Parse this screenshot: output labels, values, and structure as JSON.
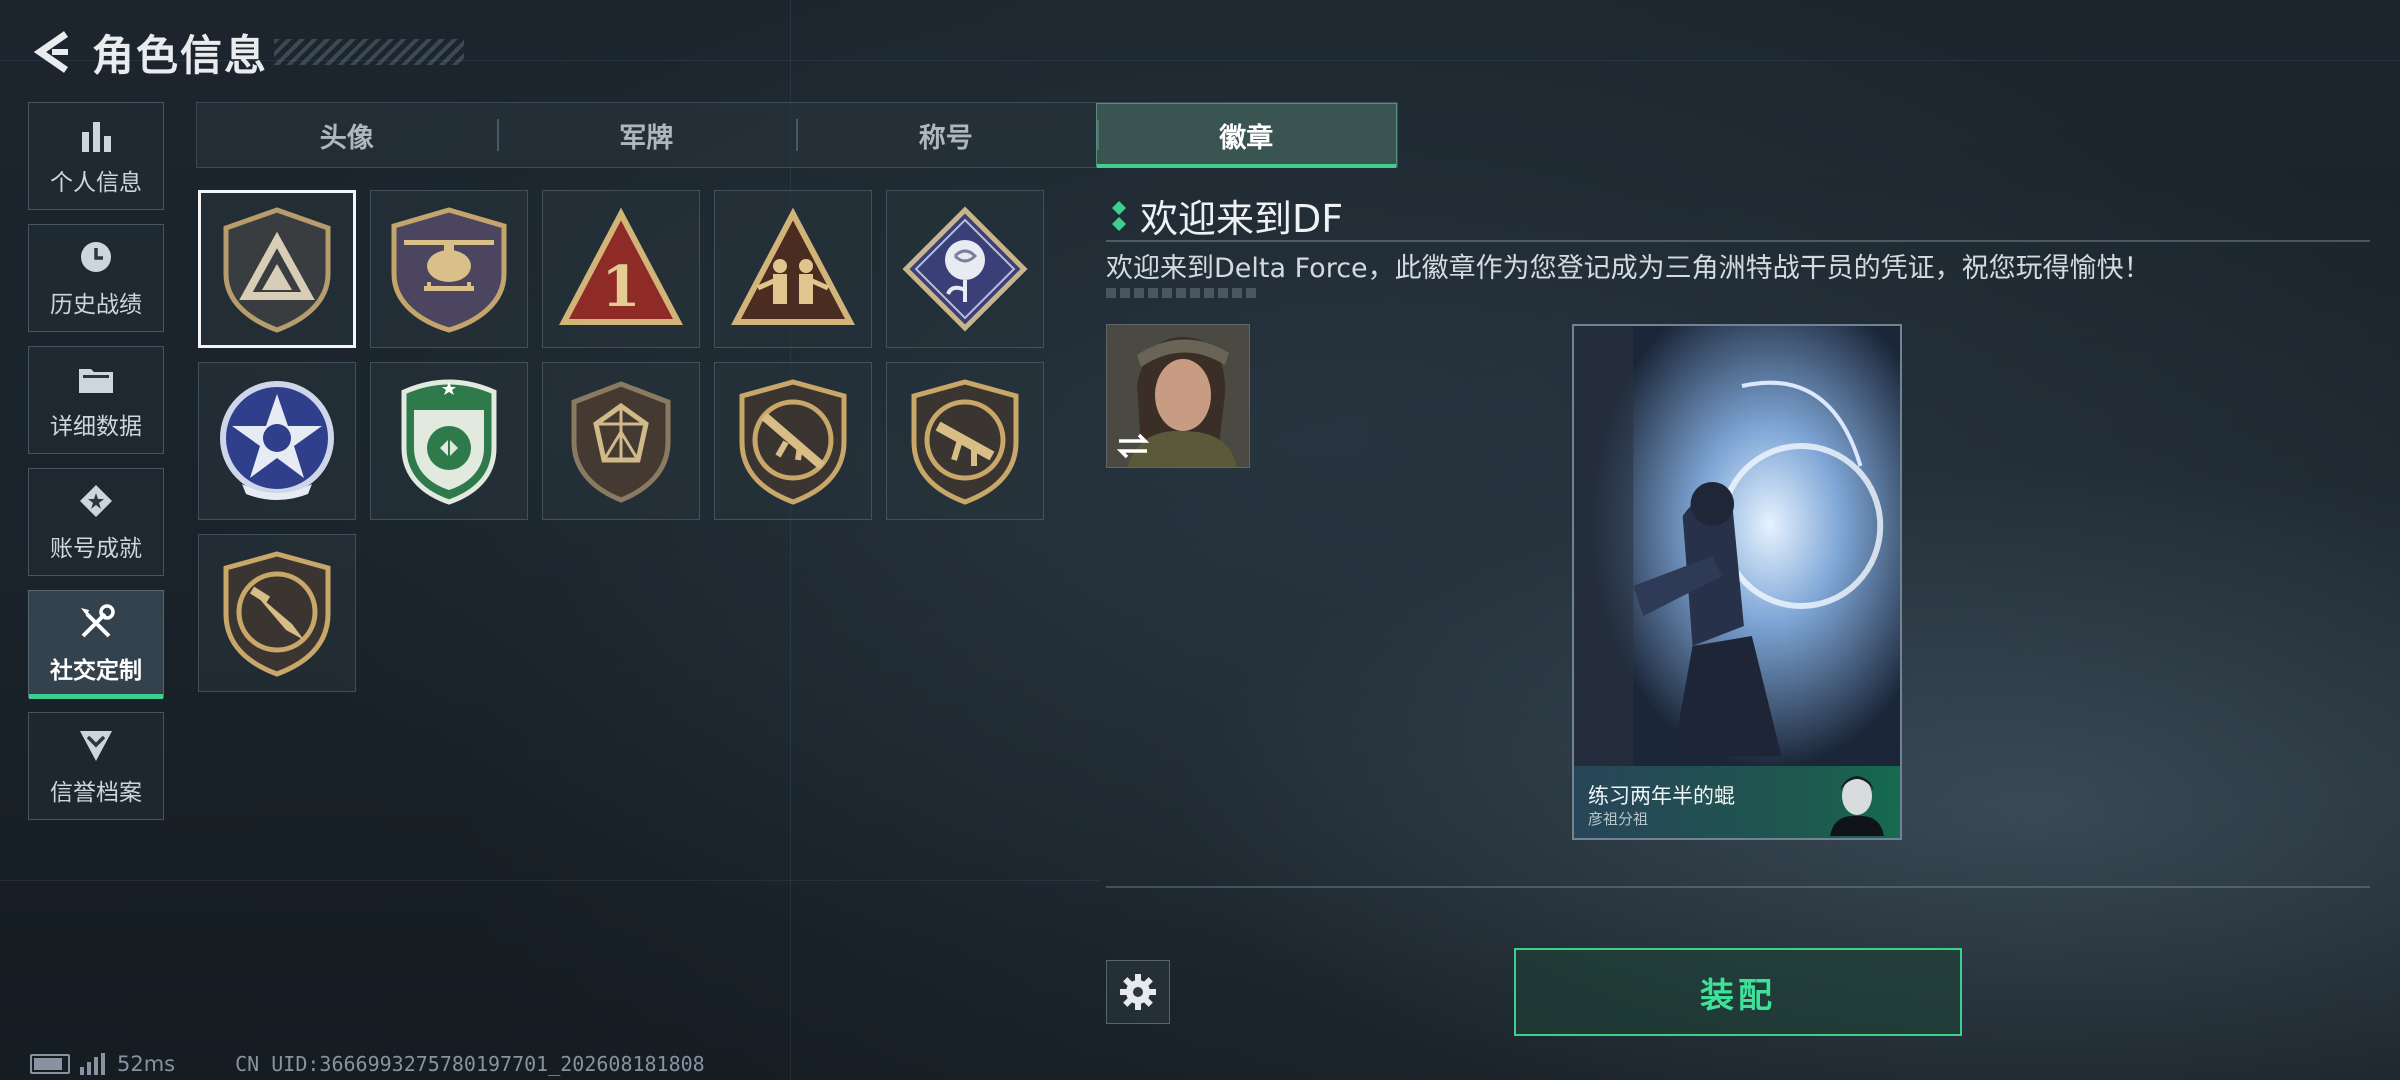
{
  "header": {
    "title": "角色信息"
  },
  "side_nav": [
    {
      "label": "个人信息",
      "icon": "bar-chart-icon"
    },
    {
      "label": "历史战绩",
      "icon": "clock-icon"
    },
    {
      "label": "详细数据",
      "icon": "folder-icon"
    },
    {
      "label": "账号成就",
      "icon": "achievement-icon"
    },
    {
      "label": "社交定制",
      "icon": "tools-icon",
      "active": true
    },
    {
      "label": "信誉档案",
      "icon": "shield-chevron-icon"
    }
  ],
  "tabs": [
    {
      "label": "头像"
    },
    {
      "label": "军牌"
    },
    {
      "label": "称号"
    },
    {
      "label": "徽章",
      "active": true
    }
  ],
  "badges": [
    "delta-triangle-badge-icon",
    "helicopter-badge-icon",
    "number-one-badge-icon",
    "soldiers-badge-icon",
    "rose-badge-icon",
    "skull-star-badge-icon",
    "green-shield-badge-icon",
    "gem-shield-badge-icon",
    "rifle-badge-icon",
    "smg-badge-icon",
    "knife-badge-icon"
  ],
  "detail": {
    "title": "欢迎来到DF",
    "description": "欢迎来到Delta Force，此徽章作为您登记成为三角洲特战干员的凭证，祝您玩得愉快！"
  },
  "card": {
    "name": "练习两年半的蜫",
    "subtitle": "彦祖分祖"
  },
  "equip_label": "装配",
  "status": {
    "ping": "52ms",
    "uid": "CN UID:3666993275780197701_202608181808"
  },
  "colors": {
    "accent": "#3fd08f",
    "background": "#1c252d"
  }
}
